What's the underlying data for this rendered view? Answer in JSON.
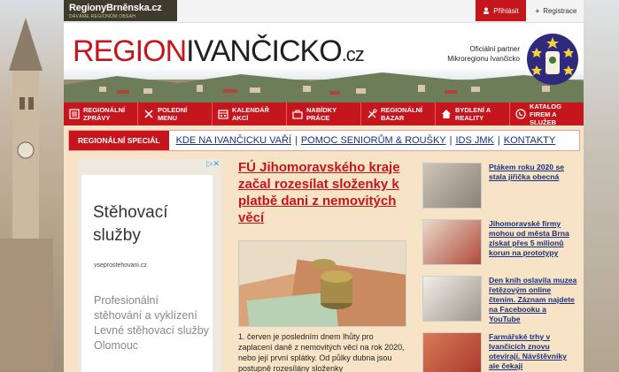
{
  "brand": {
    "name": "RegionyBrněnska.cz",
    "tagline": "DÁVÁME REGIONŮM OBSAH"
  },
  "account": {
    "login": "Přihlásit",
    "register": "Registrace"
  },
  "logo": {
    "part1": "REGION",
    "part2": "IVANČICKO",
    "part3": ".cz"
  },
  "partner": {
    "line1": "Oficiální partner",
    "line2": "Mikroregionu Ivančicko"
  },
  "nav": [
    {
      "label": "REGIONÁLNÍ ZPRÁVY",
      "icon": "newspaper-icon"
    },
    {
      "label": "POLEDNÍ MENU",
      "icon": "cutlery-icon"
    },
    {
      "label": "KALENDÁŘ AKCÍ",
      "icon": "calendar-icon"
    },
    {
      "label": "NABÍDKY PRÁCE",
      "icon": "briefcase-icon"
    },
    {
      "label": "REGIONÁLNÍ BAZAR",
      "icon": "tools-icon"
    },
    {
      "label": "BYDLENÍ A REALITY",
      "icon": "house-icon"
    },
    {
      "label": "KATALOG FIREM A SLUŽEB",
      "icon": "phone-icon"
    }
  ],
  "special": {
    "label": "REGIONÁLNÍ SPECIÁL",
    "links": [
      "KDE NA IVANČICKU VAŘÍ",
      "POMOC SENIORŮM & ROUŠKY",
      "IDS JMK",
      "KONTAKTY"
    ]
  },
  "ad": {
    "title": "Stěhovací služby",
    "url": "vseprostehovani.cz",
    "text": "Profesionální stěhování a vyklízení Levné stěhovací služby Olomouc"
  },
  "main": {
    "title": "FÚ Jihomoravského kraje začal rozesílat složenky k platbě dani z nemovitých věcí",
    "text": "1. červen je posledním dnem lhůty pro zaplacení daně z nemovitých věcí na rok 2020, nebo její první splátky. Od půlky dubna jsou postupně rozesílány složenky"
  },
  "side": [
    {
      "title": "Ptákem roku 2020 se stala jiřička obecná",
      "thumb": "#8a8074"
    },
    {
      "title": "Jihomoravské firmy mohou od města Brna získat přes 5 milionů korun na prototypy",
      "thumb": "#b04a3c"
    },
    {
      "title": "Den knih oslavila muzea řetězovým online čtením. Záznam najdete na Facebooku a YouTube",
      "thumb": "#d9d4cb"
    },
    {
      "title": "Farmářské trhy v Ivančicích znovu otevírají. Návštěvníky ale čekají",
      "thumb": "#a9382b"
    }
  ]
}
